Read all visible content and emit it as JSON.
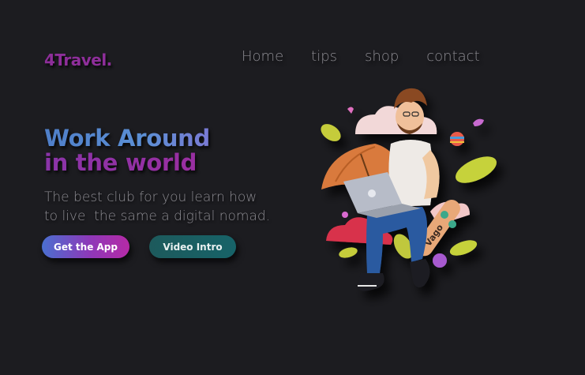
{
  "brand": {
    "logo": "4Travel."
  },
  "nav": {
    "items": [
      {
        "label": "Home"
      },
      {
        "label": "tips"
      },
      {
        "label": "shop"
      },
      {
        "label": "contact"
      }
    ]
  },
  "hero": {
    "title_line1": "Work Around",
    "title_line2": "in the world",
    "subtitle": "The best club for you learn how\nto live  the same a digital nomad."
  },
  "buttons": {
    "primary_label": "Get the App",
    "secondary_label": "Video Intro"
  },
  "illustration": {
    "skateboard_text": "Vago"
  },
  "colors": {
    "background": "#1c1c20",
    "logo": "#8e2e9a",
    "title_blue": "#5b8fd4",
    "title_purple": "#9a2ea0",
    "button_primary_start": "#4a6fd0",
    "button_primary_end": "#b52aa6",
    "button_secondary": "#176368",
    "nav_text": "#8b8a90"
  }
}
